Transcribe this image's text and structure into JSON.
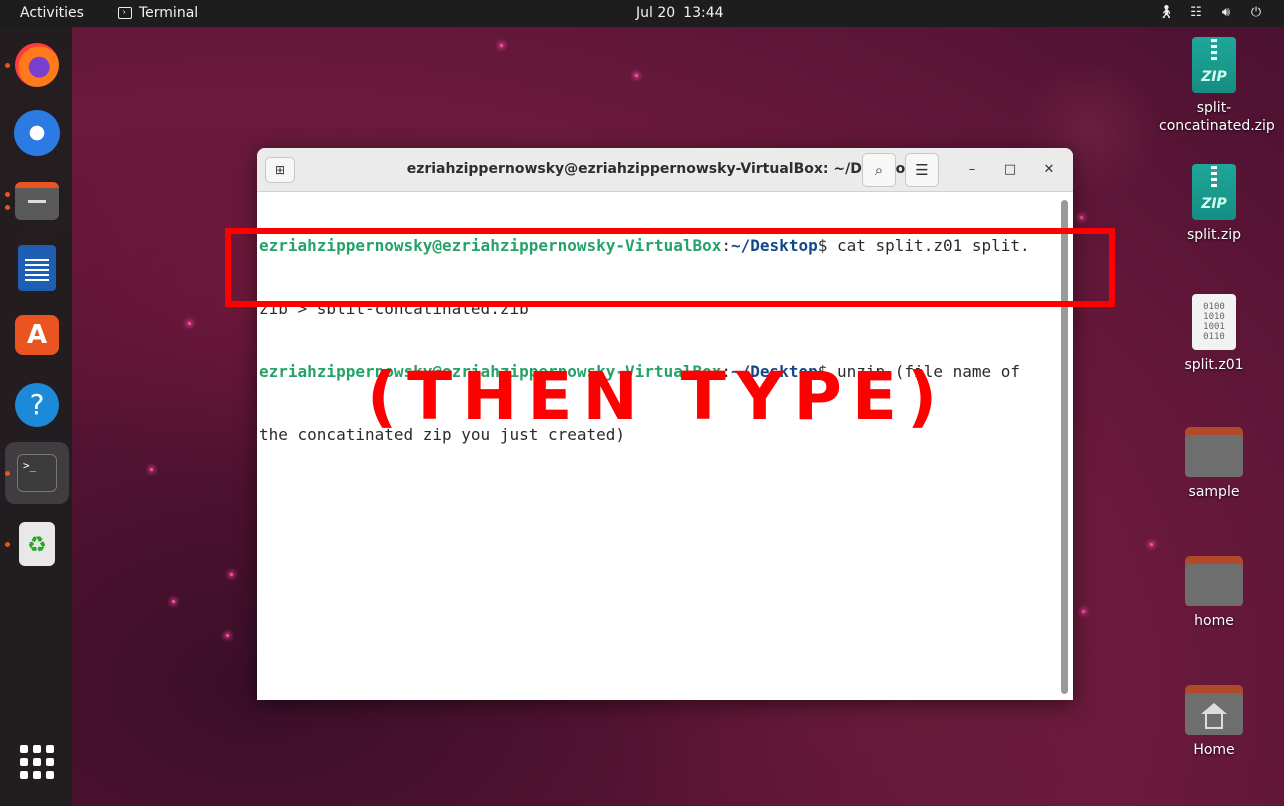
{
  "topbar": {
    "activities": "Activities",
    "app_name": "Terminal",
    "date": "Jul 20",
    "time": "13:44"
  },
  "dock": {
    "items": [
      "firefox",
      "thunderbird",
      "files",
      "libreoffice-writer",
      "app-center",
      "help",
      "terminal",
      "trash",
      "show-apps"
    ]
  },
  "desktop": {
    "icons": [
      {
        "label": "split-\nconcatinated.zip",
        "type": "zip"
      },
      {
        "label": "split.zip",
        "type": "zip"
      },
      {
        "label": "split.z01",
        "type": "binary"
      },
      {
        "label": "sample",
        "type": "folder"
      },
      {
        "label": "home",
        "type": "folder"
      },
      {
        "label": "Home",
        "type": "home-folder"
      }
    ],
    "zip_badge": "ZIP",
    "binary_text": "0100\n1010\n1001\n0110"
  },
  "terminal": {
    "title": "ezriahzippernowsky@ezriahzippernowsky-VirtualBox: ~/Desktop",
    "lines": [
      {
        "user": "ezriahzippernowsky@ezriahzippernowsky-VirtualBox",
        "sep": ":",
        "path": "~/Desktop",
        "dollar": "$",
        "cmd": " cat split.z01 split."
      },
      {
        "text": "zip > split-concatinated.zip"
      },
      {
        "user": "ezriahzippernowsky@ezriahzippernowsky-VirtualBox",
        "sep": ":",
        "path": "~/Desktop",
        "dollar": "$",
        "cmd": " unzip (file name of"
      },
      {
        "text": "the concatinated zip you just created)"
      }
    ]
  },
  "annotation": {
    "text": "(THEN TYPE)",
    "color": "#ff0000"
  },
  "colors": {
    "prompt_user": "#26a269",
    "prompt_path": "#12488b",
    "accent": "#e95420"
  }
}
